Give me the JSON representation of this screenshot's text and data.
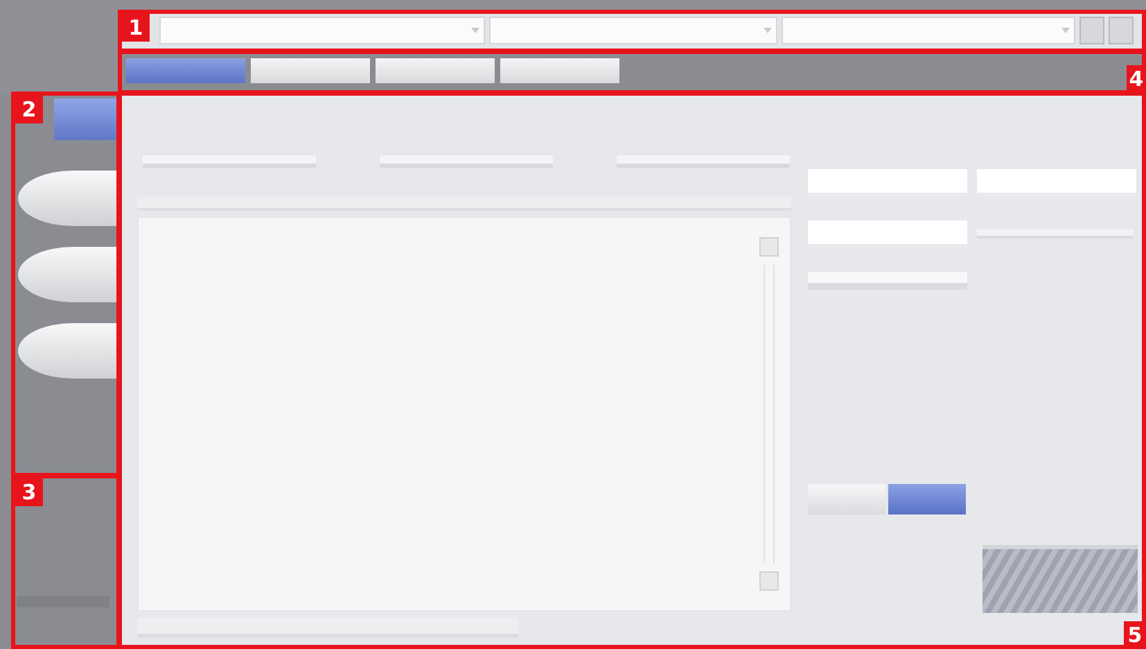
{
  "annotations": [
    {
      "label": "1"
    },
    {
      "label": "2"
    },
    {
      "label": "3"
    },
    {
      "label": "4"
    },
    {
      "label": "5"
    }
  ],
  "toolbar": [
    {
      "kind": "combo"
    },
    {
      "kind": "combo"
    },
    {
      "kind": "combo"
    },
    {
      "kind": "icon-button"
    },
    {
      "kind": "icon-button"
    }
  ],
  "tabs": [
    {
      "selected": true
    },
    {
      "selected": false
    },
    {
      "selected": false
    },
    {
      "selected": false
    }
  ],
  "sidebar": [
    {
      "kind": "highlight",
      "selected": true
    },
    {
      "kind": "pill",
      "selected": false
    },
    {
      "kind": "pill",
      "selected": false
    },
    {
      "kind": "pill",
      "selected": false
    }
  ],
  "buttons": [
    {
      "selected": false
    },
    {
      "selected": true
    }
  ]
}
